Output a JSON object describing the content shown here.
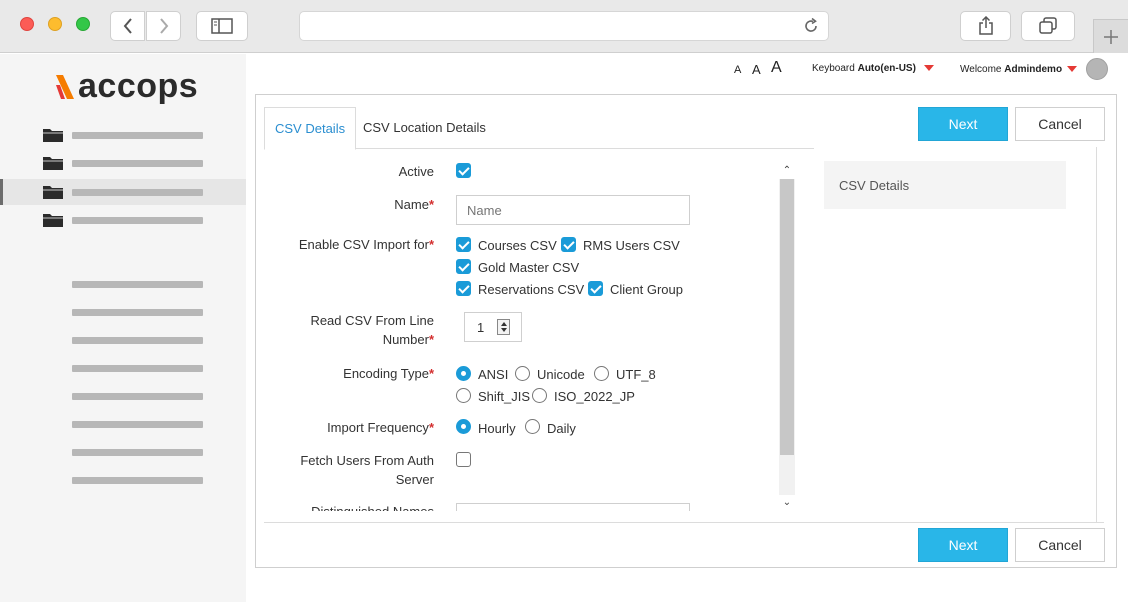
{
  "app": {
    "logo_text": "accops"
  },
  "header": {
    "font_sizes": [
      "A",
      "A",
      "A"
    ],
    "keyboard_label": "Keyboard",
    "keyboard_value": "Auto(en-US)",
    "welcome_label": "Welcome",
    "username": "Admindemo"
  },
  "tabs": [
    {
      "label": "CSV Details",
      "active": true
    },
    {
      "label": "CSV Location Details",
      "active": false
    }
  ],
  "buttons": {
    "next": "Next",
    "cancel": "Cancel"
  },
  "form": {
    "active": {
      "label": "Active",
      "checked": true
    },
    "name": {
      "label": "Name",
      "required": "*",
      "placeholder": "Name",
      "value": ""
    },
    "enable_import": {
      "label": "Enable CSV Import for",
      "required": "*",
      "options": [
        {
          "label": "Courses CSV",
          "checked": true
        },
        {
          "label": "RMS Users CSV",
          "checked": true
        },
        {
          "label": "Gold Master CSV",
          "checked": true
        },
        {
          "label": "Reservations CSV",
          "checked": true
        },
        {
          "label": "Client Group",
          "checked": true
        }
      ]
    },
    "read_line": {
      "label_line1": "Read CSV From Line",
      "label_line2": "Number",
      "required": "*",
      "value": "1"
    },
    "encoding": {
      "label": "Encoding Type",
      "required": "*",
      "options": [
        {
          "label": "ANSI",
          "selected": true
        },
        {
          "label": "Unicode",
          "selected": false
        },
        {
          "label": "UTF_8",
          "selected": false
        },
        {
          "label": "Shift_JIS",
          "selected": false
        },
        {
          "label": "ISO_2022_JP",
          "selected": false
        }
      ]
    },
    "frequency": {
      "label": "Import Frequency",
      "required": "*",
      "options": [
        {
          "label": "Hourly",
          "selected": true
        },
        {
          "label": "Daily",
          "selected": false
        }
      ]
    },
    "fetch_users": {
      "label_line1": "Fetch Users From Auth",
      "label_line2": "Server",
      "checked": false
    },
    "distinguished_names": {
      "label": "Distinguished Names"
    }
  },
  "side_panel": {
    "title": "CSV Details"
  },
  "colors": {
    "accent": "#29b6e8",
    "checkbox": "#1a9bd8",
    "required": "#d32f2f",
    "caret": "#e53935"
  }
}
